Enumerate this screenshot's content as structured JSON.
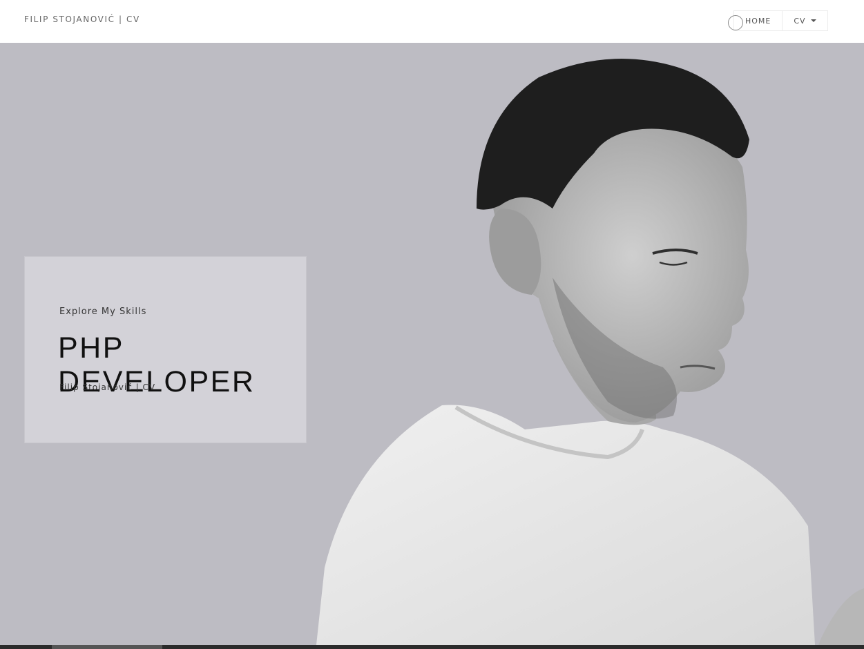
{
  "header": {
    "brand": "FILIP STOJANOVIĆ | CV",
    "nav": [
      {
        "label": "HOME"
      },
      {
        "label": "CV"
      }
    ]
  },
  "hero": {
    "kicker": "Explore My Skills",
    "title": "PHP DEVELOPER",
    "subtitle": "Filip Stojanović | CV"
  },
  "colors": {
    "header_bg": "#ffffff",
    "hero_bg": "#bdbcc3",
    "card_bg": "#d3d2d8",
    "text_dark": "#111111"
  },
  "icons": {
    "dropdown": "caret-down-icon"
  }
}
